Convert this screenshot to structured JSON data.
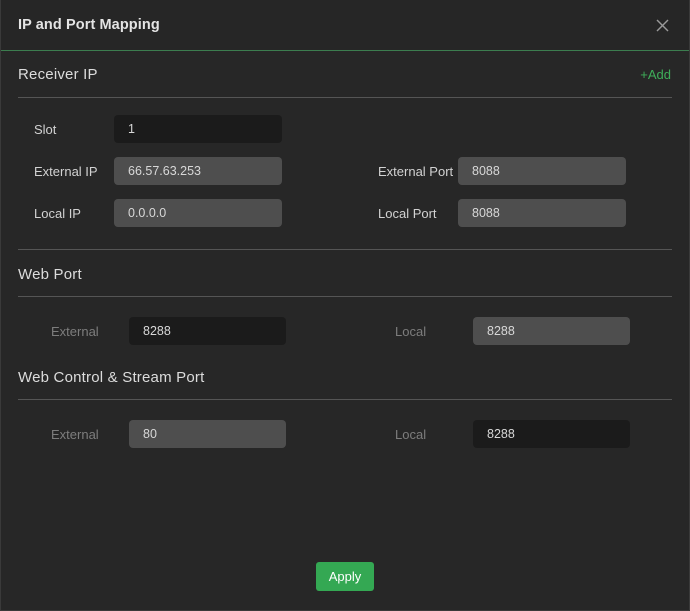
{
  "window": {
    "title": "IP and Port Mapping",
    "close_icon": "close-icon"
  },
  "theme": {
    "background": "#272727",
    "accent_green": "#3fae5a",
    "button_green": "#34a853",
    "header_rule": "#3c7d4f",
    "divider": "#555555",
    "field_dark": "#1b1b1b",
    "field_light": "#4e4e4e",
    "text": "#d6d6d6",
    "text_dim": "#7d7d7d"
  },
  "sections": {
    "receiver_ip": {
      "title": "Receiver IP",
      "add_label": "+Add",
      "fields": {
        "slot": {
          "label": "Slot",
          "value": "1",
          "style": "dark"
        },
        "external_ip": {
          "label": "External IP",
          "value": "66.57.63.253",
          "style": "light"
        },
        "local_ip": {
          "label": "Local IP",
          "value": "0.0.0.0",
          "style": "light"
        },
        "external_port": {
          "label": "External Port",
          "value": "8088",
          "style": "light"
        },
        "local_port": {
          "label": "Local Port",
          "value": "8088",
          "style": "light"
        }
      }
    },
    "web_port": {
      "title": "Web Port",
      "fields": {
        "external": {
          "label": "External",
          "value": "8288",
          "style": "dark"
        },
        "local": {
          "label": "Local",
          "value": "8288",
          "style": "light"
        }
      }
    },
    "web_control_stream_port": {
      "title": "Web Control & Stream Port",
      "fields": {
        "external": {
          "label": "External",
          "value": "80",
          "style": "light"
        },
        "local": {
          "label": "Local",
          "value": "8288",
          "style": "dark"
        }
      }
    }
  },
  "footer": {
    "apply_label": "Apply"
  }
}
